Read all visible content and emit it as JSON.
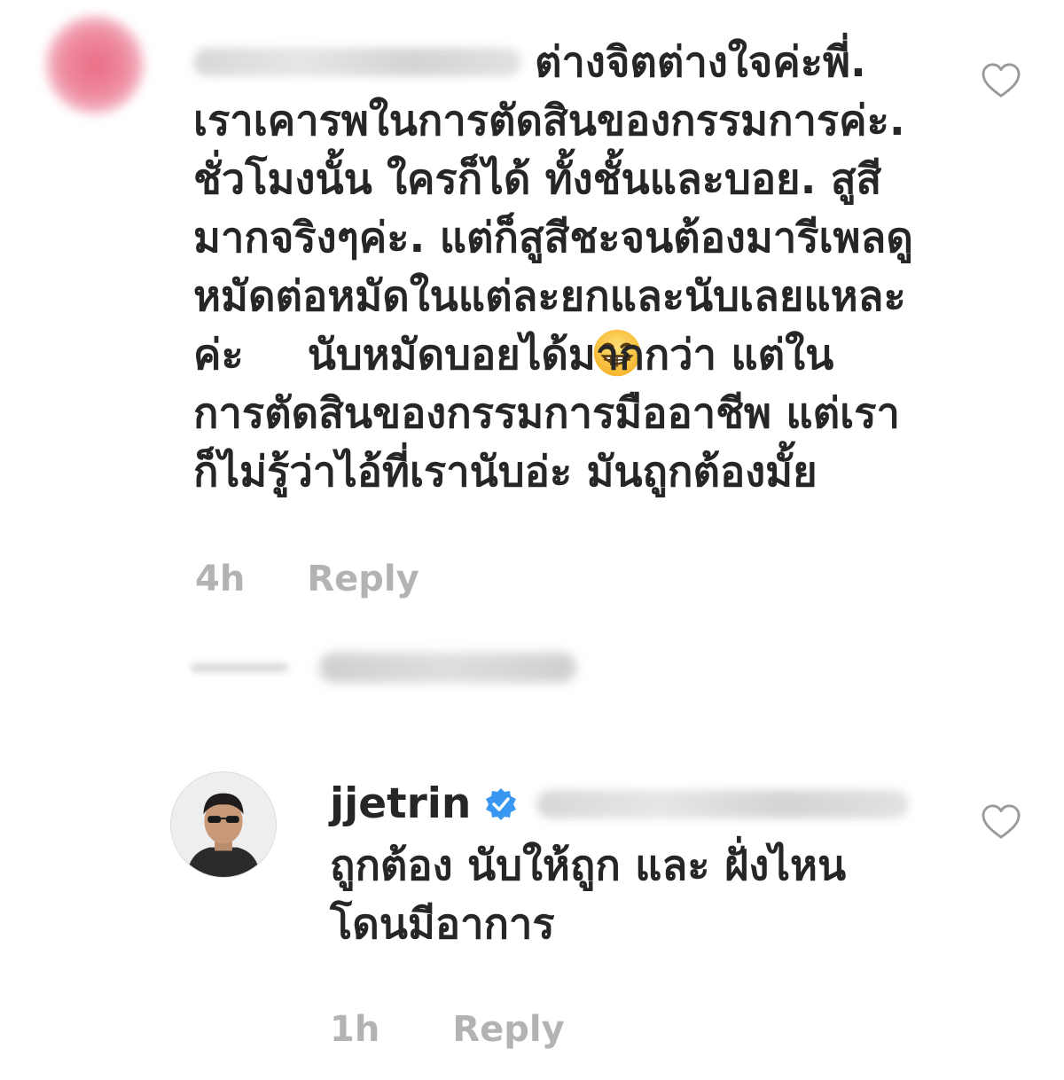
{
  "comments": [
    {
      "text_line_1": "ต่างจิตต่างใจค่ะพี่.",
      "text_rest_a": "เราเคารพในการตัดสินของกรรมการค่ะ.\nชั่วโมงนั้น ใครก็ได้ ทั้งชั้นและบอย. สูสี\nมากจริงๆค่ะ. แต่ก็สูสีชะจนต้องมารีเพลดู\nหมัดต่อหมัดในแต่ละยกและนับเลยแหละ\nค่ะ",
      "emoji": "grinning-squinting-face",
      "text_rest_b": "นับหมัดบอยได้มากกว่า แต่ใน\nการตัดสินของกรรมการมืออาชีพ แต่เรา\nก็ไม่รู้ว่าไอ้ที่เรานับอ่ะ มันถูกต้องมั้ย",
      "time": "4h",
      "reply_label": "Reply",
      "heart_icon": "heart-outline-icon",
      "avatar_color": "#ea6d87"
    },
    {
      "username": "jjetrin",
      "verified_color": "#3897f0",
      "text": "ถูกต้อง นับให้ถูก และ ฝั่งไหน\nโดนมีอาการ",
      "time": "1h",
      "reply_label": "Reply",
      "heart_icon": "heart-outline-icon"
    }
  ],
  "colors": {
    "text": "#262626",
    "meta": "#b3b3b3",
    "background": "#ffffff"
  }
}
